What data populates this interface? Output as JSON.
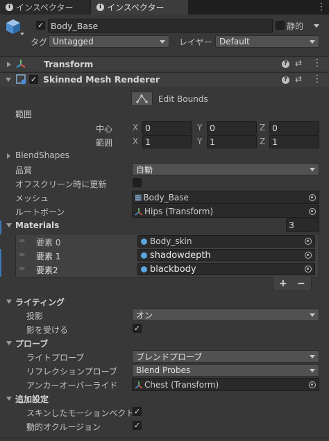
{
  "tabs": [
    {
      "label": "インスペクター"
    },
    {
      "label": "インスペクター"
    }
  ],
  "object": {
    "name": "Body_Base",
    "static_label": "静的",
    "tag_label": "タグ",
    "tag_value": "Untagged",
    "layer_label": "レイヤー",
    "layer_value": "Default"
  },
  "components": {
    "transform": "Transform",
    "smr": "Skinned Mesh Renderer"
  },
  "bounds": {
    "edit_label": "Edit Bounds",
    "section_label": "範囲",
    "center_label": "中心",
    "extent_label": "範囲",
    "x": "X",
    "y": "Y",
    "z": "Z",
    "center": {
      "x": "0",
      "y": "0",
      "z": "0"
    },
    "extent": {
      "x": "1",
      "y": "1",
      "z": "1"
    }
  },
  "props": {
    "blendshapes": "BlendShapes",
    "quality_label": "品質",
    "quality_value": "自動",
    "offscreen_label": "オフスクリーン時に更新",
    "mesh_label": "メッシュ",
    "mesh_value": "Body_Base",
    "rootbone_label": "ルートボーン",
    "rootbone_value": "Hips (Transform)"
  },
  "materials": {
    "label": "Materials",
    "count": "3",
    "items": [
      {
        "label": "要素 0",
        "value": "Body_skin"
      },
      {
        "label": "要素 1",
        "value": "shadowdepth"
      },
      {
        "label": "要素2",
        "value": "blackbody"
      }
    ],
    "add": "+",
    "remove": "−"
  },
  "lighting": {
    "label": "ライティング",
    "cast_label": "投影",
    "cast_value": "オン",
    "receive_label": "影を受ける"
  },
  "probes": {
    "label": "プローブ",
    "light_label": "ライトプローブ",
    "light_value": "ブレンドプローブ",
    "reflection_label": "リフレクションプローブ",
    "reflection_value": "Blend Probes",
    "anchor_label": "アンカーオーバーライド",
    "anchor_value": "Chest (Transform)"
  },
  "additional": {
    "label": "追加設定",
    "motion_label": "スキンしたモーションベクト",
    "occlusion_label": "動的オクルージョン"
  },
  "icons": {
    "check": "✓",
    "checkbox_on": "check-icon"
  },
  "colors": {
    "accent": "#3a79bb",
    "bg": "#383838"
  }
}
